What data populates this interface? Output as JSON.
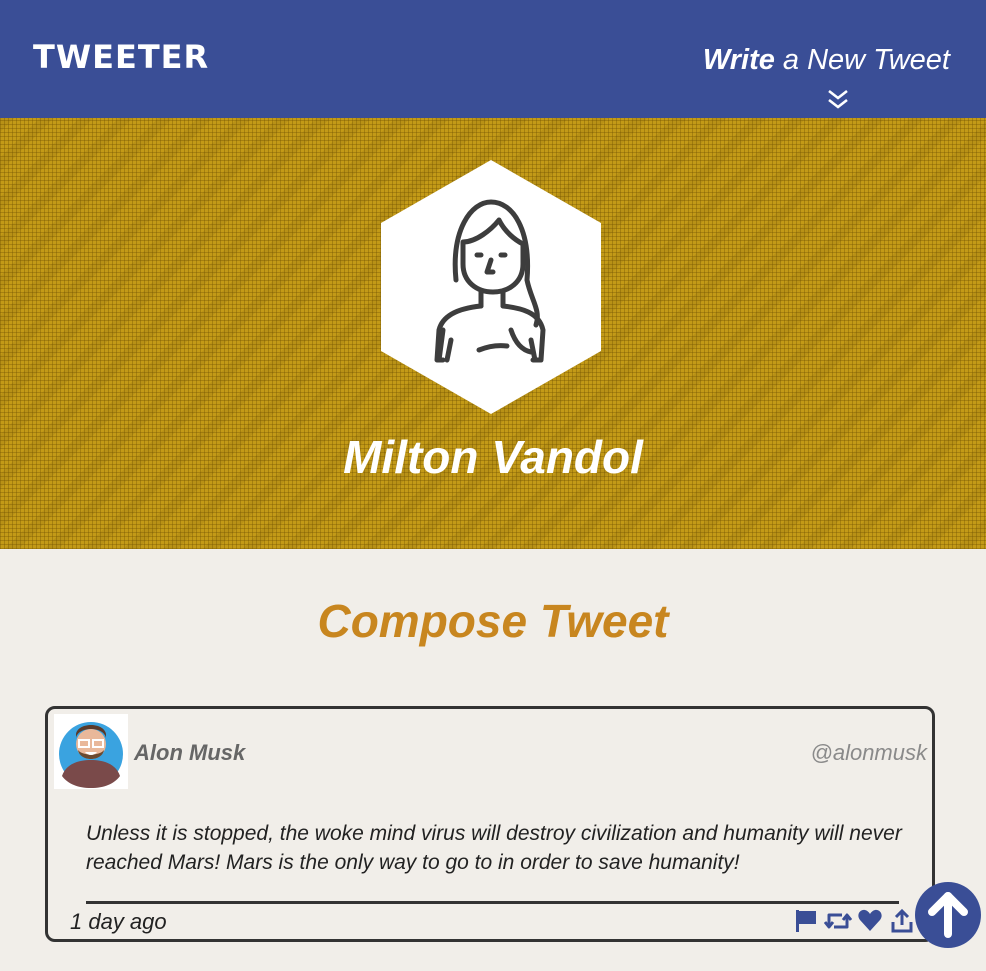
{
  "nav": {
    "logo": "TWEETER",
    "write_strong": "Write",
    "write_rest": " a New Tweet",
    "chevron_icon": "double-chevron-down-icon"
  },
  "profile": {
    "name": "Milton Vandol",
    "avatar_icon": "woman-avatar-icon",
    "banner_color": "#c39a17"
  },
  "compose": {
    "title": "Compose Tweet"
  },
  "tweet": {
    "author": "Alon Musk",
    "handle": "@alonmusk",
    "text": "Unless it is stopped, the woke mind virus will destroy civilization and humanity will never reached Mars! Mars is the only way to go to in order to save humanity!",
    "timestamp": "1 day ago",
    "actions": [
      "flag-icon",
      "retweet-icon",
      "heart-icon",
      "share-icon"
    ]
  },
  "colors": {
    "nav": "#3a4e96",
    "accent": "#c8861f",
    "background": "#f1eee9"
  },
  "scroll_top_icon": "arrow-up-icon"
}
